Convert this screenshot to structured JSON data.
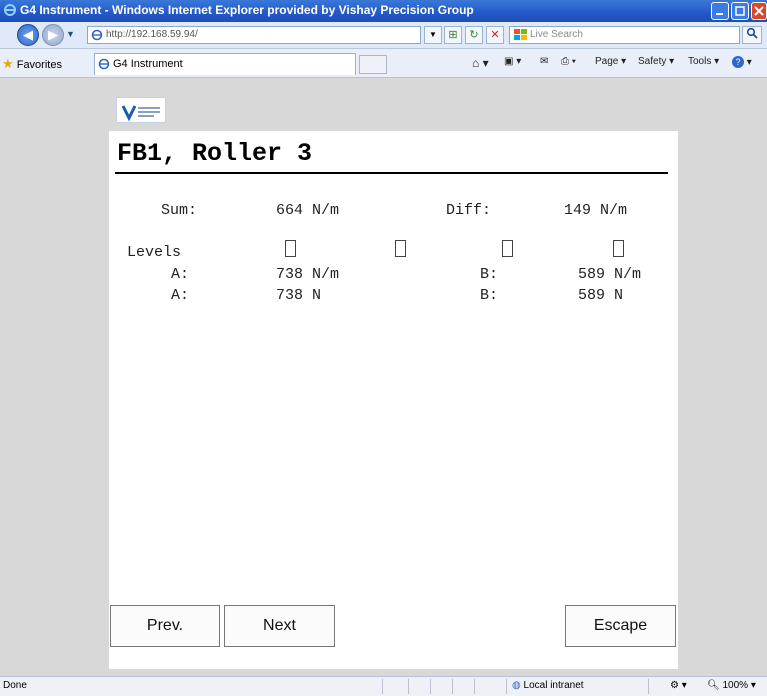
{
  "window": {
    "title": "G4 Instrument - Windows Internet Explorer provided by Vishay Precision Group"
  },
  "addressbar": {
    "url": "http://192.168.59.94/",
    "search_placeholder": "Live Search"
  },
  "favorites_bar": {
    "favorites_label": "Favorites",
    "tab_title": "G4 Instrument",
    "commands": [
      "Page ▾",
      "Safety ▾",
      "Tools ▾"
    ]
  },
  "page": {
    "logo_text": "VISHAY PRECISION GROUP",
    "heading": "FB1, Roller 3",
    "sum_label": "Sum:",
    "sum_value": "664 N/m",
    "diff_label": "Diff:",
    "diff_value": "149 N/m",
    "levels_label": "Levels",
    "row1": {
      "a_label": "A:",
      "a_value": "738 N/m",
      "b_label": "B:",
      "b_value": "589 N/m"
    },
    "row2": {
      "a_label": "A:",
      "a_value": "738 N",
      "b_label": "B:",
      "b_value": "589 N"
    },
    "buttons": {
      "prev": "Prev.",
      "next": "Next",
      "escape": "Escape"
    }
  },
  "statusbar": {
    "status": "Done",
    "zone": "Local intranet",
    "zoom": "100%"
  },
  "colors": {
    "titlebar": "#2358c8",
    "panel": "#ffffff",
    "page_bg": "#d8d8d8"
  }
}
